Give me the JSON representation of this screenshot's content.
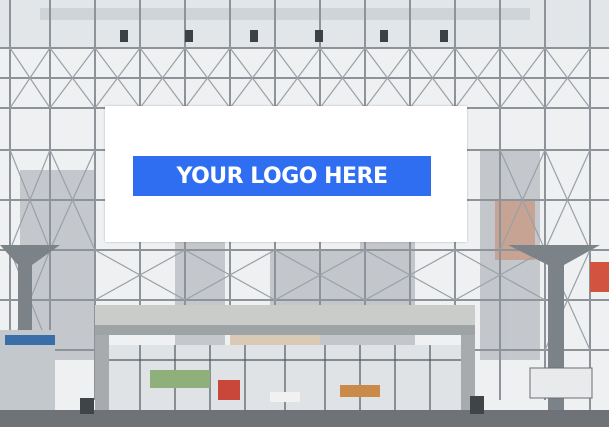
{
  "scene": {
    "description_name": "convention-center-atrium-billboard",
    "billboard": {
      "logo_text": "YOUR LOGO HERE",
      "logo_bg_color": "#2f6ef0",
      "logo_text_color": "#ffffff",
      "panel_color": "#ffffff"
    },
    "colors": {
      "frame_steel": "#8a9096",
      "frame_dark": "#5b6167",
      "canopy": "#c9ccc9",
      "floor": "#6f7377",
      "glass_tint": "#dfe3e6"
    }
  }
}
